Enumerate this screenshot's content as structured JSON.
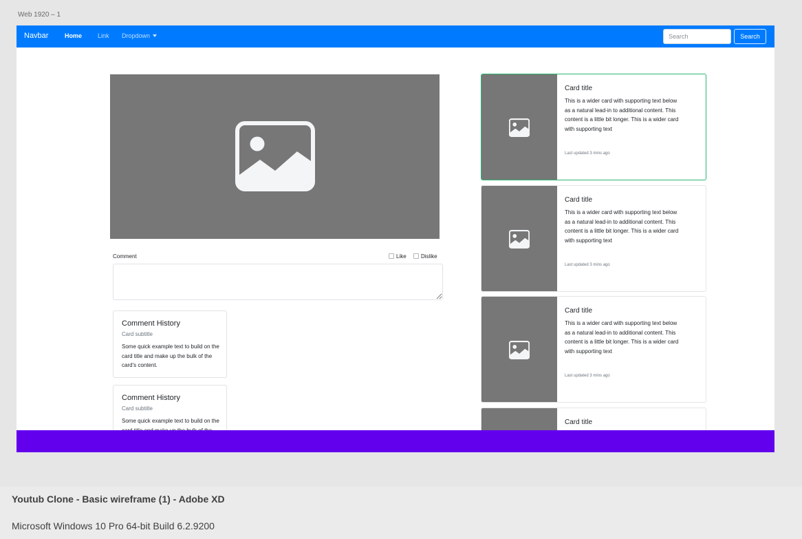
{
  "artboard_label": "Web 1920 – 1",
  "navbar": {
    "brand": "Navbar",
    "links": [
      "Home",
      "Link",
      "Dropdown"
    ],
    "search_placeholder": "Search",
    "search_button": "Search",
    "color": "#007bff"
  },
  "comment": {
    "label": "Comment",
    "like": "Like",
    "dislike": "Dislike"
  },
  "history_cards": [
    {
      "title": "Comment History",
      "subtitle": "Card subtitle",
      "text": "Some quick example text to build on the card title and make up the bulk of the card's content."
    },
    {
      "title": "Comment History",
      "subtitle": "Card subtitle",
      "text": "Some quick example text to build on the card title and make up the bulk of the card's content."
    }
  ],
  "side_cards": [
    {
      "title": "Card title",
      "text": "This is a wider card with supporting text below as a natural lead-in to additional content. This content is a little bit longer. This is a wider card with supporting text",
      "updated": "Last updated 3 mins ago"
    },
    {
      "title": "Card title",
      "text": "This is a wider card with supporting text below as a natural lead-in to additional content. This content is a little bit longer. This is a wider card with supporting text",
      "updated": "Last updated 3 mins ago"
    },
    {
      "title": "Card title",
      "text": "This is a wider card with supporting text below as a natural lead-in to additional content. This content is a little bit longer. This is a wider card with supporting text",
      "updated": "Last updated 3 mins ago"
    },
    {
      "title": "Card title",
      "text": "",
      "updated": ""
    }
  ],
  "footer_color": "#6200ee",
  "selected_card_border": "#2bb673",
  "window_title": "Youtub Clone - Basic wireframe (1) - Adobe XD",
  "os_info": "Microsoft Windows 10 Pro 64-bit Build 6.2.9200"
}
